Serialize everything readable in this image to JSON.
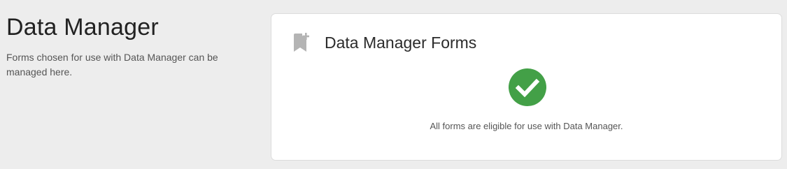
{
  "page": {
    "title": "Data Manager",
    "description": "Forms chosen for use with Data Manager can be managed here."
  },
  "card": {
    "icon": "bookmark-add-icon",
    "title": "Data Manager Forms",
    "status_icon": "check-circle-icon",
    "status_color": "#43a047",
    "message": "All forms are eligible for use with Data Manager."
  }
}
